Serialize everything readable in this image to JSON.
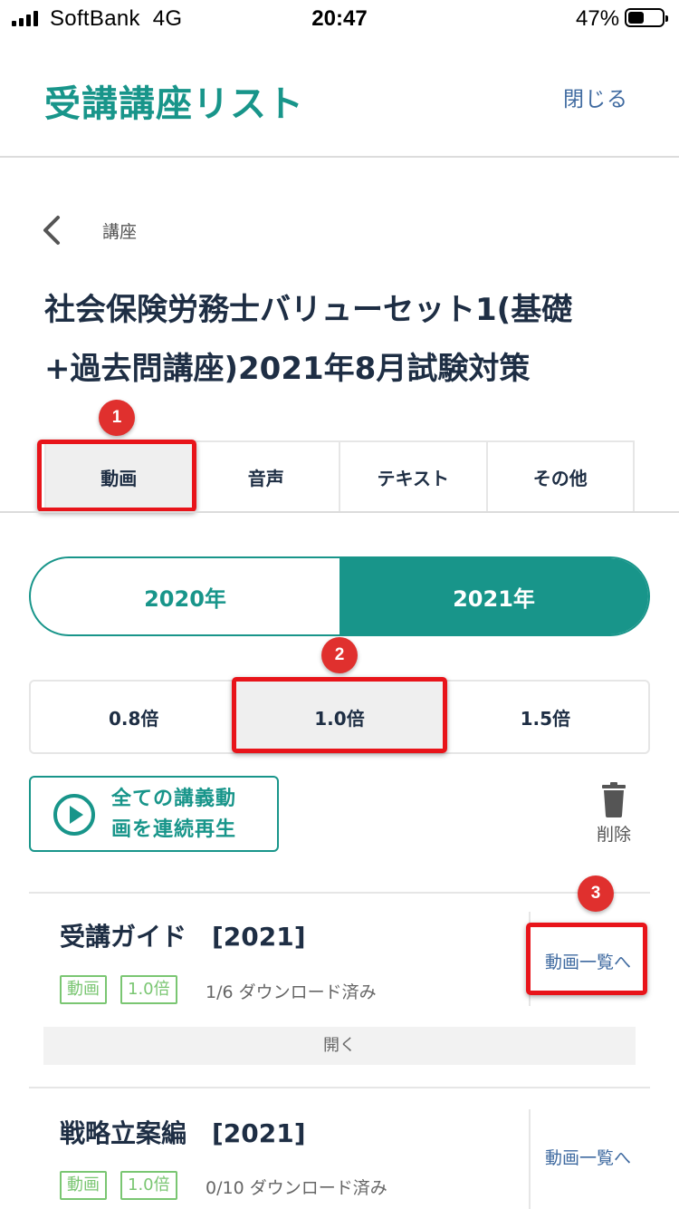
{
  "status_bar": {
    "carrier": "SoftBank  4G",
    "time": "20:47",
    "battery": "47%"
  },
  "header": {
    "title": "受講講座リスト",
    "close": "閉じる"
  },
  "breadcrumb": "講座",
  "course_title_line1": "社会保険労務士バリューセット1(基礎",
  "course_title_line2": "+過去問講座)2021年8月試験対策",
  "annotations": [
    "1",
    "2",
    "3"
  ],
  "media_tabs": [
    {
      "label": "動画",
      "active": true
    },
    {
      "label": "音声",
      "active": false
    },
    {
      "label": "テキスト",
      "active": false
    },
    {
      "label": "その他",
      "active": false
    }
  ],
  "years": [
    {
      "label": "2020年",
      "active": false
    },
    {
      "label": "2021年",
      "active": true
    }
  ],
  "speeds": [
    {
      "label": "0.8倍",
      "active": false
    },
    {
      "label": "1.0倍",
      "active": true
    },
    {
      "label": "1.5倍",
      "active": false
    }
  ],
  "play_all": {
    "line1": "全ての講義動",
    "line2": "画を連続再生"
  },
  "delete_label": "削除",
  "courses": [
    {
      "name": "受講ガイド　[2021]",
      "tags": [
        "動画",
        "1.0倍"
      ],
      "download_status": "1/6 ダウンロード済み",
      "link": "動画一覧へ",
      "open": "開く"
    },
    {
      "name": "戦略立案編　[2021]",
      "tags": [
        "動画",
        "1.0倍"
      ],
      "download_status": "0/10 ダウンロード済み",
      "link": "動画一覧へ"
    }
  ],
  "colors": {
    "accent": "#18958a",
    "link": "#3f6aa0",
    "tag": "#7ac672",
    "highlight": "#e8141a"
  }
}
